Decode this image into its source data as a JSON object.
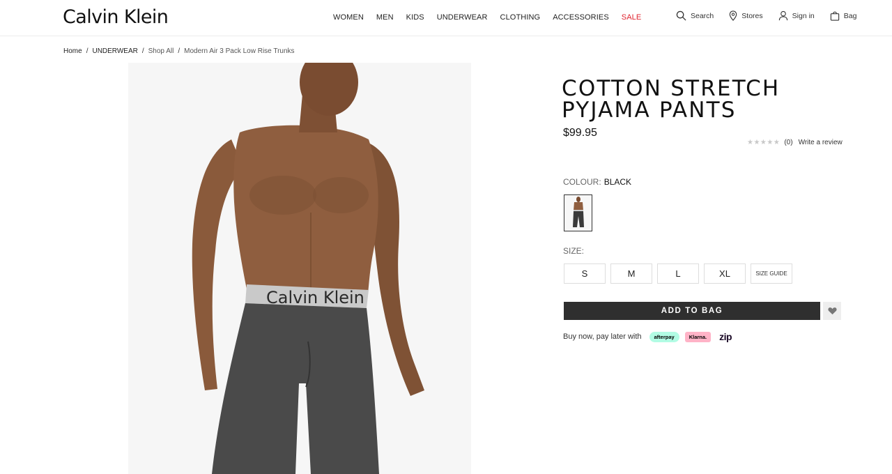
{
  "header": {
    "logo": "Calvin Klein",
    "nav": [
      {
        "label": "WOMEN"
      },
      {
        "label": "MEN"
      },
      {
        "label": "KIDS"
      },
      {
        "label": "UNDERWEAR"
      },
      {
        "label": "CLOTHING"
      },
      {
        "label": "ACCESSORIES"
      },
      {
        "label": "SALE"
      }
    ],
    "utilities": {
      "search": "Search",
      "stores": "Stores",
      "sign_in": "Sign in",
      "bag": "Bag"
    }
  },
  "breadcrumb": [
    "Home",
    "UNDERWEAR",
    "Shop All",
    "Modern Air 3 Pack Low Rise Trunks"
  ],
  "product": {
    "title_line1": "COTTON STRETCH",
    "title_line2": "PYJAMA PANTS",
    "price": "$99.95",
    "rating_count": "(0)",
    "write_review": "Write a review",
    "colour_label": "COLOUR:",
    "colour_value": "BLACK",
    "size_label": "SIZE:",
    "sizes": [
      "S",
      "M",
      "L",
      "XL"
    ],
    "size_guide": "SIZE GUIDE",
    "add_to_bag": "ADD TO BAG",
    "bnpl_text": "Buy now, pay later with",
    "afterpay": "afterpay",
    "klarna": "Klarna.",
    "zip": "zip"
  },
  "image_text": {
    "waistband": "Calvin Klein"
  },
  "colors": {
    "sale": "#e0232e",
    "button": "#2f2f2f",
    "afterpay": "#b2fce4",
    "klarna": "#ffb3c7"
  }
}
